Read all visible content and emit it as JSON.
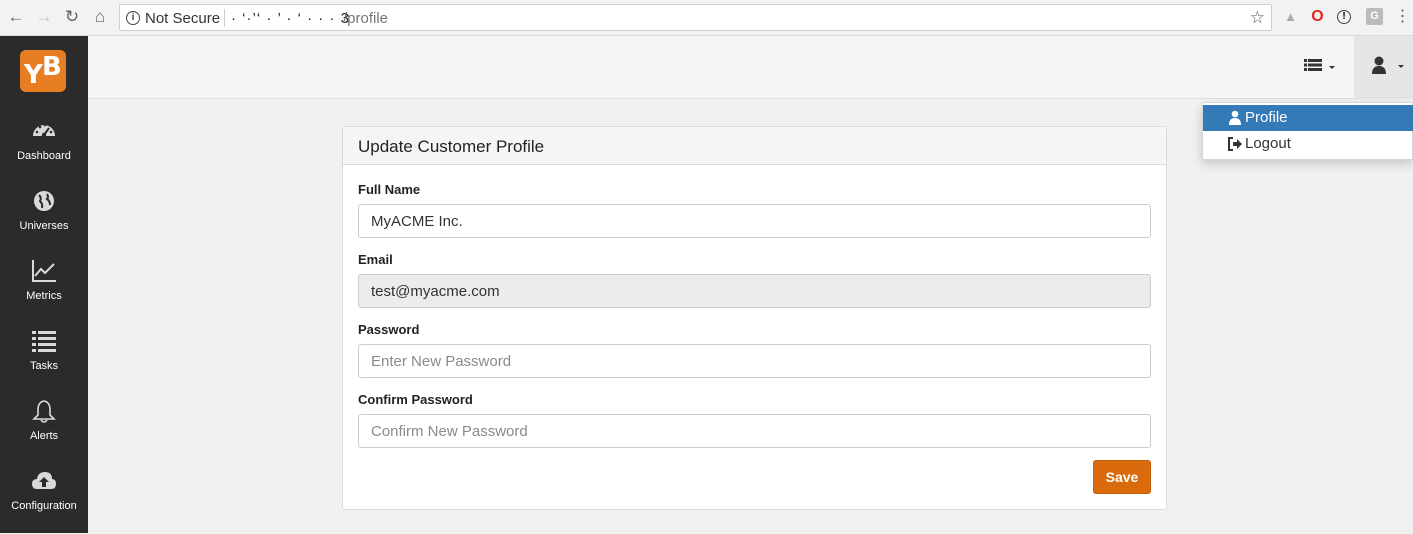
{
  "browser": {
    "security_label": "Not Secure",
    "host": "· ‘·’‘ · ’ · ‘ · · · 3",
    "path": "/profile"
  },
  "sidebar": {
    "logo_text_left": "Y",
    "logo_text_right": "B",
    "items": [
      {
        "label": "Dashboard",
        "icon": "dashboard-icon"
      },
      {
        "label": "Universes",
        "icon": "globe-icon"
      },
      {
        "label": "Metrics",
        "icon": "line-chart-icon"
      },
      {
        "label": "Tasks",
        "icon": "list-icon"
      },
      {
        "label": "Alerts",
        "icon": "bell-icon"
      },
      {
        "label": "Configuration",
        "icon": "cloud-upload-icon"
      }
    ]
  },
  "header": {
    "menu_icon": "list-menu-icon",
    "user_icon": "user-icon"
  },
  "user_menu": {
    "items": [
      {
        "label": "Profile",
        "icon": "user-icon",
        "active": true
      },
      {
        "label": "Logout",
        "icon": "sign-out-icon",
        "active": false
      }
    ]
  },
  "form": {
    "title": "Update Customer Profile",
    "full_name": {
      "label": "Full Name",
      "value": "MyACME Inc."
    },
    "email": {
      "label": "Email",
      "value": "test@myacme.com"
    },
    "password": {
      "label": "Password",
      "placeholder": "Enter New Password"
    },
    "confirm_password": {
      "label": "Confirm Password",
      "placeholder": "Confirm New Password"
    },
    "save_label": "Save"
  },
  "colors": {
    "accent": "#d96b0d",
    "sidebar_bg": "#2b2b2b",
    "active_menu": "#337ab7"
  }
}
